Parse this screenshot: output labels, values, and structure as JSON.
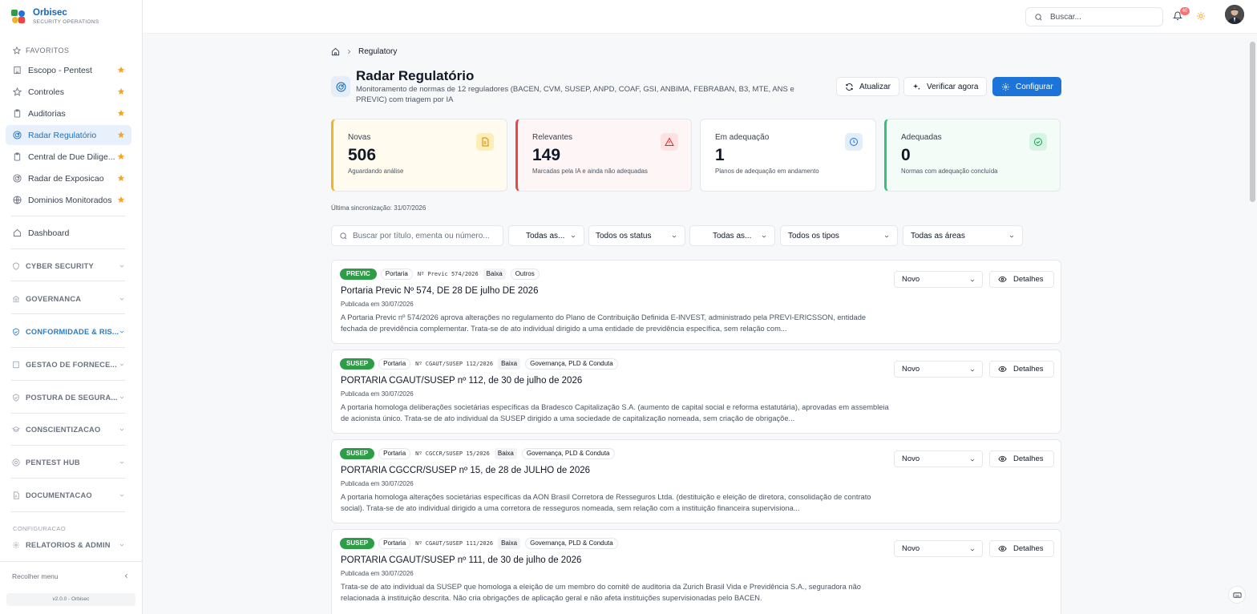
{
  "brand": {
    "name": "Orbisec",
    "subtitle": "SECURITY OPERATIONS"
  },
  "sidebar": {
    "favorites_label": "FAVORITOS",
    "favorites": [
      {
        "label": "Escopo - Pentest",
        "icon": "building-icon"
      },
      {
        "label": "Controles",
        "icon": "star-outline-icon"
      },
      {
        "label": "Auditorias",
        "icon": "clipboard-icon"
      },
      {
        "label": "Radar Regulatório",
        "icon": "radar-icon",
        "active": true
      },
      {
        "label": "Central de Due Dilige...",
        "icon": "clipboard-icon"
      },
      {
        "label": "Radar de Exposicao",
        "icon": "radar-icon"
      },
      {
        "label": "Dominios Monitorados",
        "icon": "globe-icon"
      }
    ],
    "dashboard": "Dashboard",
    "groups": [
      {
        "label": "CYBER SECURITY",
        "icon": "shield-icon"
      },
      {
        "label": "GOVERNANCA",
        "icon": "bank-icon"
      },
      {
        "label": "CONFORMIDADE & RIS...",
        "icon": "shield-check-icon",
        "active": true
      },
      {
        "label": "GESTAO DE FORNECE...",
        "icon": "building-icon"
      },
      {
        "label": "POSTURA DE SEGURA...",
        "icon": "shield-check-icon"
      },
      {
        "label": "CONSCIENTIZACAO",
        "icon": "graduation-icon"
      },
      {
        "label": "PENTEST HUB",
        "icon": "target-icon"
      },
      {
        "label": "DOCUMENTACAO",
        "icon": "file-icon"
      }
    ],
    "config_label": "CONFIGURACAO",
    "config_group": {
      "label": "RELATORIOS & ADMIN",
      "icon": "gear-icon"
    },
    "collapse_label": "Recolher menu",
    "version": "v2.0.0 - Orbisec"
  },
  "topbar": {
    "search_placeholder": "Buscar...",
    "notification_count": "40"
  },
  "breadcrumb": {
    "current": "Regulatory"
  },
  "header": {
    "title": "Radar Regulatório",
    "description": "Monitoramento de normas de 12 reguladores (BACEN, CVM, SUSEP, ANPD, COAF, GSI, ANBIMA, FEBRABAN, B3, MTE, ANS e PREVIC) com triagem por IA",
    "btn_refresh": "Atualizar",
    "btn_check": "Verificar agora",
    "btn_config": "Configurar"
  },
  "stats": [
    {
      "label": "Novas",
      "value": "506",
      "sub": "Aguardando análise",
      "accent": "#f0b429",
      "bg": "#fffbef",
      "icon": "document-icon"
    },
    {
      "label": "Relevantes",
      "value": "149",
      "sub": "Marcadas pela IA e ainda não adequadas",
      "accent": "#ef4444",
      "bg": "#fef6f6",
      "icon": "alert-triangle-icon"
    },
    {
      "label": "Em adequação",
      "value": "1",
      "sub": "Planos de adequação em andamento",
      "accent": "#e5e7eb",
      "bg": "#ffffff",
      "icon": "clock-icon"
    },
    {
      "label": "Adequadas",
      "value": "0",
      "sub": "Normas com adequação concluída",
      "accent": "#34c27a",
      "bg": "#f3fcf7",
      "icon": "check-circle-icon"
    }
  ],
  "sync_text": "Última sincronização: 31/07/2026",
  "filters": {
    "search_placeholder": "Buscar por título, ementa ou número...",
    "regulator": "Todas as...",
    "status": "Todos os status",
    "relevance": "Todas as...",
    "type": "Todos os tipos",
    "area": "Todas as áreas"
  },
  "items": [
    {
      "org": "PREVIC",
      "type": "Portaria",
      "number": "Nº Previc 574/2026",
      "severity": "Baixa",
      "area": "Outros",
      "title": "Portaria Previc Nº 574, DE 28 DE julho DE 2026",
      "date": "Publicada em 30/07/2026",
      "desc": "A Portaria Previc nº 574/2026 aprova alterações no regulamento do Plano de Contribuição Definida E-INVEST, administrado pela PREVI-ERICSSON, entidade fechada de previdência complementar. Trata-se de ato individual dirigido a uma entidade de previdência específica, sem relação com...",
      "status": "Novo",
      "details": "Detalhes"
    },
    {
      "org": "SUSEP",
      "type": "Portaria",
      "number": "Nº CGAUT/SUSEP 112/2026",
      "severity": "Baixa",
      "area": "Governança, PLD & Conduta",
      "title": "PORTARIA CGAUT/SUSEP nº 112, de 30 de julho de 2026",
      "date": "Publicada em 30/07/2026",
      "desc": "A portaria homologa deliberações societárias específicas da Bradesco Capitalização S.A. (aumento de capital social e reforma estatutária), aprovadas em assembleia de acionista único. Trata-se de ato individual da SUSEP dirigido a uma sociedade de capitalização nomeada, sem criação de obrigaçõe...",
      "status": "Novo",
      "details": "Detalhes"
    },
    {
      "org": "SUSEP",
      "type": "Portaria",
      "number": "Nº CGCCR/SUSEP 15/2026",
      "severity": "Baixa",
      "area": "Governança, PLD & Conduta",
      "title": "PORTARIA CGCCR/SUSEP nº 15, de 28 de JULHO de 2026",
      "date": "Publicada em 30/07/2026",
      "desc": "A portaria homologa alterações societárias específicas da AON Brasil Corretora de Resseguros Ltda. (destituição e eleição de diretora, consolidação de contrato social). Trata-se de ato individual dirigido a uma corretora de resseguros nomeada, sem relação com a instituição financeira supervisiona...",
      "status": "Novo",
      "details": "Detalhes"
    },
    {
      "org": "SUSEP",
      "type": "Portaria",
      "number": "Nº CGAUT/SUSEP 111/2026",
      "severity": "Baixa",
      "area": "Governança, PLD & Conduta",
      "title": "PORTARIA CGAUT/SUSEP nº 111, de 30 de julho de 2026",
      "date": "Publicada em 30/07/2026",
      "desc": "Trata-se de ato individual da SUSEP que homologa a eleição de um membro do comitê de auditoria da Zurich Brasil Vida e Previdência S.A., seguradora não relacionada à instituição descrita. Não cria obrigações de aplicação geral e não afeta instituições supervisionadas pelo BACEN.",
      "status": "Novo",
      "details": "Detalhes"
    }
  ]
}
